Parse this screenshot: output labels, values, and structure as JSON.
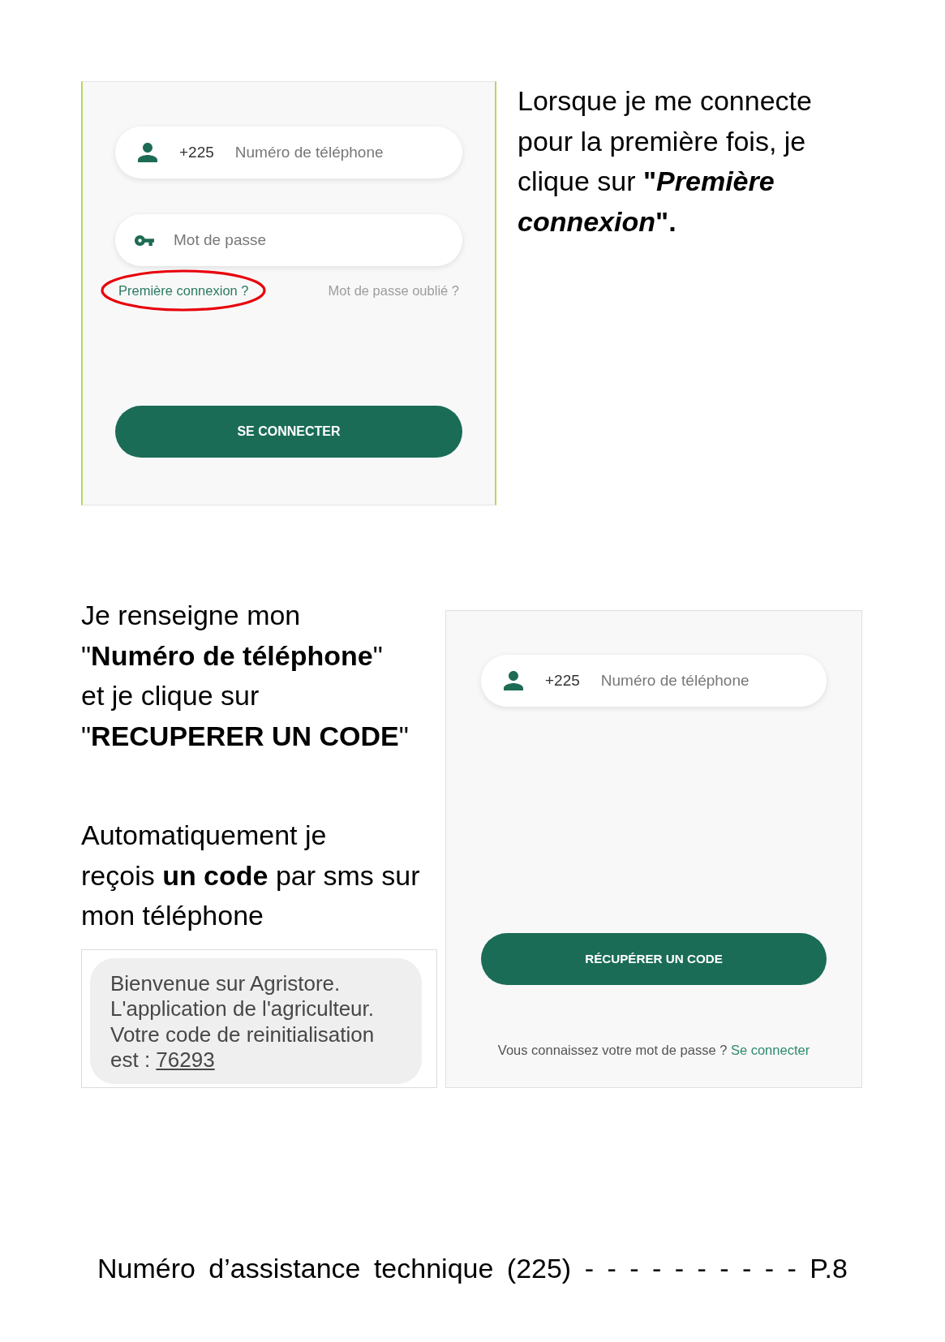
{
  "step_1": {
    "screen": {
      "phone_field": {
        "prefix": "+225",
        "placeholder": "Numéro de téléphone"
      },
      "password_field": {
        "placeholder": "Mot de passe"
      },
      "links": [
        {
          "label": "Première connexion ?",
          "kind": "primary",
          "circled": true
        },
        {
          "label": "Mot de passe oublié ?",
          "kind": "muted",
          "circled": false
        }
      ],
      "button": "SE CONNECTER"
    },
    "instruction": "Lorsque je me connecte\npour la première fois, je\nclique sur **\"*Première\nconnexion*\".**"
  },
  "step_2": {
    "instructions": [
      "Je renseigne mon\n\"**Numéro de téléphone**\"\net je clique sur\n\"**RECUPERER UN CODE**\"",
      "Automatiquement je\nreçois **un code** par sms sur\nmon téléphone"
    ],
    "sms": {
      "text": "Bienvenue sur Agristore.\nL'application de l'agriculteur.\nVotre code de reinitialisation\nest :",
      "code": "76293"
    },
    "screen": {
      "phone_field": {
        "prefix": "+225",
        "placeholder": "Numéro de téléphone"
      },
      "button": "RÉCUPÉRER UN CODE",
      "prompt": "Vous connaissez votre mot de passe ?",
      "link": "Se connecter"
    }
  },
  "footer": "Numéro d’assistance technique (225) - - - - - - - - - - P.8"
}
